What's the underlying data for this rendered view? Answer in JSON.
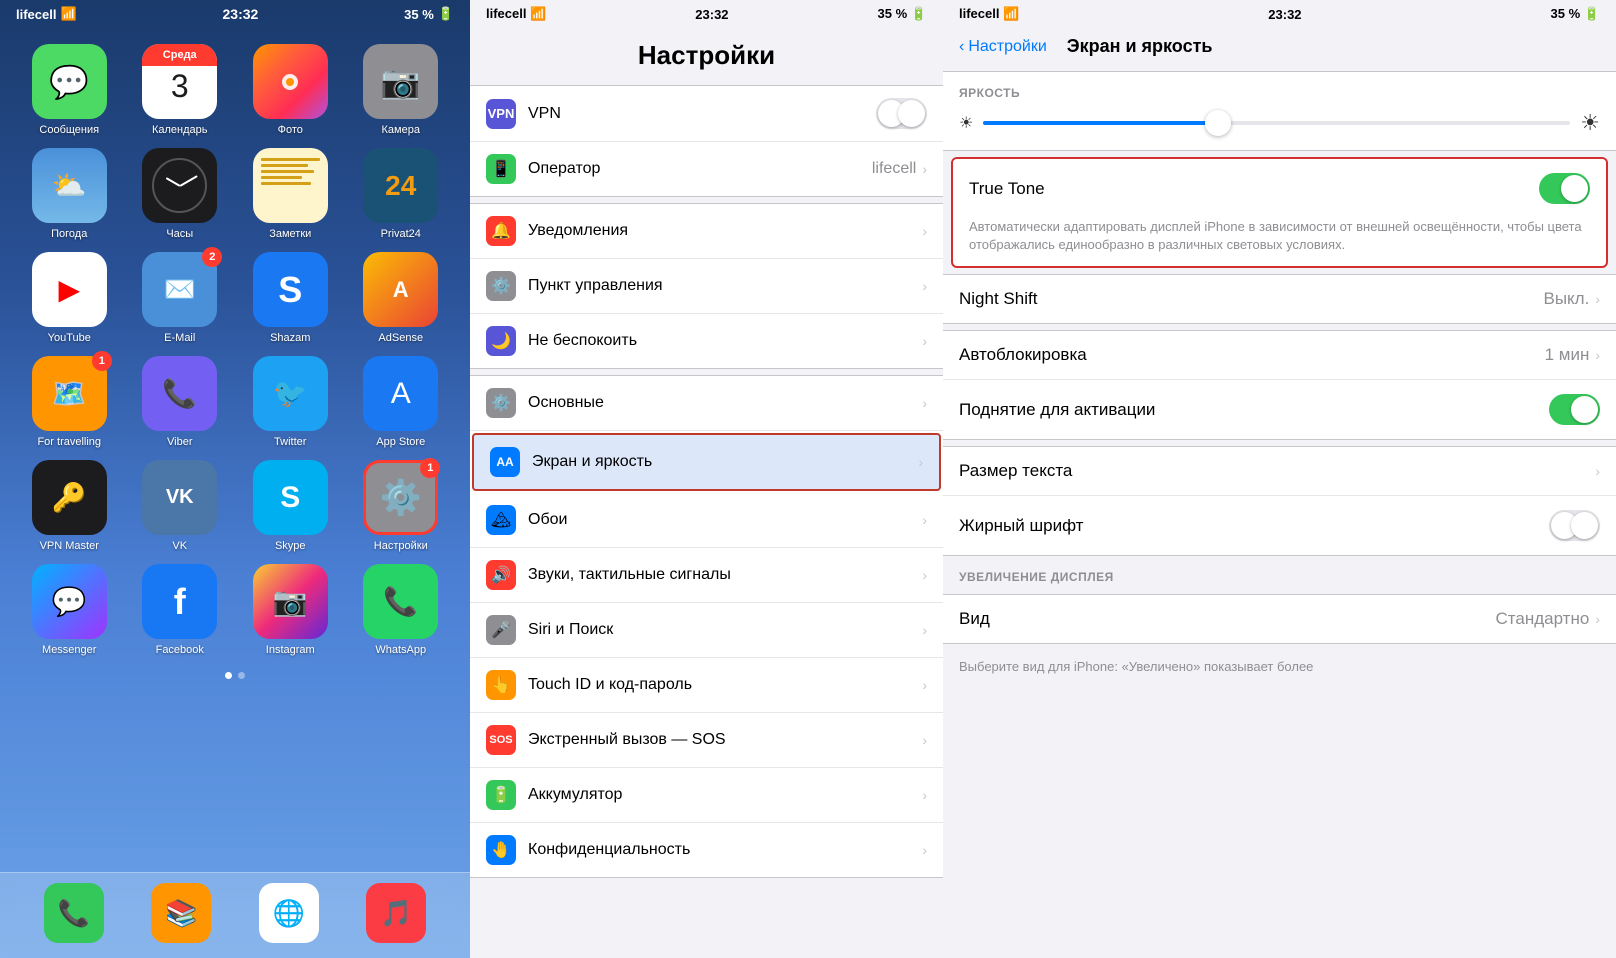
{
  "homescreen": {
    "status": {
      "carrier": "lifecell",
      "time": "23:32",
      "battery": "35 %",
      "signal": "●●●"
    },
    "apps": [
      {
        "id": "messages",
        "label": "Сообщения",
        "colorClass": "app-messages",
        "icon": "💬",
        "badge": null
      },
      {
        "id": "calendar",
        "label": "Календарь",
        "colorClass": "app-calendar",
        "icon": "",
        "badge": null
      },
      {
        "id": "photos",
        "label": "Фото",
        "colorClass": "app-photos",
        "icon": "🌸",
        "badge": null
      },
      {
        "id": "camera",
        "label": "Камера",
        "colorClass": "app-camera",
        "icon": "📷",
        "badge": null
      },
      {
        "id": "weather",
        "label": "Погода",
        "colorClass": "app-weather",
        "icon": "🌤",
        "badge": null
      },
      {
        "id": "clock",
        "label": "Часы",
        "colorClass": "app-clock",
        "icon": "",
        "badge": null
      },
      {
        "id": "notes",
        "label": "Заметки",
        "colorClass": "app-notes",
        "icon": "",
        "badge": null
      },
      {
        "id": "privat24",
        "label": "Privat24",
        "colorClass": "app-privat24",
        "icon": "24",
        "badge": null
      },
      {
        "id": "youtube",
        "label": "YouTube",
        "colorClass": "app-youtube",
        "icon": "▶",
        "badge": null
      },
      {
        "id": "email",
        "label": "E-Mail",
        "colorClass": "app-email",
        "icon": "✉️",
        "badge": "2"
      },
      {
        "id": "shazam",
        "label": "Shazam",
        "colorClass": "app-shazam",
        "icon": "S",
        "badge": null
      },
      {
        "id": "adsense",
        "label": "AdSense",
        "colorClass": "app-adsense",
        "icon": "A",
        "badge": null
      },
      {
        "id": "travelling",
        "label": "For travelling",
        "colorClass": "app-travelling",
        "icon": "📍",
        "badge": "1"
      },
      {
        "id": "viber",
        "label": "Viber",
        "colorClass": "app-viber",
        "icon": "📞",
        "badge": null
      },
      {
        "id": "twitter",
        "label": "Twitter",
        "colorClass": "app-twitter",
        "icon": "🐦",
        "badge": null
      },
      {
        "id": "appstore",
        "label": "App Store",
        "colorClass": "app-appstore",
        "icon": "A",
        "badge": null
      },
      {
        "id": "vpnmaster",
        "label": "VPN Master",
        "colorClass": "app-vpnmaster",
        "icon": "🔑",
        "badge": null
      },
      {
        "id": "vk",
        "label": "VK",
        "colorClass": "app-vk",
        "icon": "VK",
        "badge": null
      },
      {
        "id": "skype",
        "label": "Skype",
        "colorClass": "app-skype",
        "icon": "S",
        "badge": null
      },
      {
        "id": "settings",
        "label": "Настройки",
        "colorClass": "app-settings",
        "icon": "⚙️",
        "badge": "1"
      },
      {
        "id": "messenger",
        "label": "Messenger",
        "colorClass": "app-messenger",
        "icon": "💬",
        "badge": null
      },
      {
        "id": "facebook",
        "label": "Facebook",
        "colorClass": "app-facebook",
        "icon": "f",
        "badge": null
      },
      {
        "id": "instagram",
        "label": "Instagram",
        "colorClass": "app-instagram",
        "icon": "📷",
        "badge": null
      },
      {
        "id": "whatsapp",
        "label": "WhatsApp",
        "colorClass": "app-whatsapp",
        "icon": "📞",
        "badge": null
      }
    ],
    "dock": [
      {
        "id": "phone",
        "icon": "📞",
        "color": "#34c759"
      },
      {
        "id": "books",
        "icon": "📚",
        "color": "#ff9500"
      },
      {
        "id": "chrome",
        "icon": "🌐",
        "color": "#4285f4"
      },
      {
        "id": "music",
        "icon": "🎵",
        "color": "#fc3c44"
      }
    ],
    "calendarDay": "3",
    "calendarWeekday": "Среда"
  },
  "settings": {
    "status": {
      "carrier": "lifecell",
      "time": "23:32",
      "battery": "35 %"
    },
    "title": "Настройки",
    "rows": [
      {
        "id": "vpn",
        "icon": "🔒",
        "iconColor": "#5856d6",
        "label": "VPN",
        "value": "",
        "hasToggle": true,
        "toggleOn": false
      },
      {
        "id": "operator",
        "icon": "📱",
        "iconColor": "#34c759",
        "label": "Оператор",
        "value": "lifecell",
        "hasChevron": true
      },
      {
        "id": "notifications",
        "icon": "🔔",
        "iconColor": "#ff3b30",
        "label": "Уведомления",
        "value": "",
        "hasChevron": true
      },
      {
        "id": "control",
        "icon": "⚙️",
        "iconColor": "#8e8e93",
        "label": "Пункт управления",
        "value": "",
        "hasChevron": true
      },
      {
        "id": "dnd",
        "icon": "🌙",
        "iconColor": "#5856d6",
        "label": "Не беспокоить",
        "value": "",
        "hasChevron": true
      },
      {
        "id": "general",
        "icon": "⚙️",
        "iconColor": "#8e8e93",
        "label": "Основные",
        "value": "",
        "hasChevron": true
      },
      {
        "id": "display",
        "icon": "AA",
        "iconColor": "#007aff",
        "label": "Экран и яркость",
        "value": "",
        "hasChevron": true,
        "highlighted": true
      },
      {
        "id": "wallpaper",
        "icon": "🏔",
        "iconColor": "#007aff",
        "label": "Обои",
        "value": "",
        "hasChevron": true
      },
      {
        "id": "sounds",
        "icon": "🔊",
        "iconColor": "#ff3b30",
        "label": "Звуки, тактильные сигналы",
        "value": "",
        "hasChevron": true
      },
      {
        "id": "siri",
        "icon": "🎤",
        "iconColor": "#8e8e93",
        "label": "Siri и Поиск",
        "value": "",
        "hasChevron": true
      },
      {
        "id": "touchid",
        "icon": "👆",
        "iconColor": "#ff9500",
        "label": "Touch ID и код-пароль",
        "value": "",
        "hasChevron": true
      },
      {
        "id": "sos",
        "icon": "🆘",
        "iconColor": "#ff3b30",
        "label": "Экстренный вызов — SOS",
        "value": "",
        "hasChevron": true
      },
      {
        "id": "battery",
        "icon": "🔋",
        "iconColor": "#34c759",
        "label": "Аккумулятор",
        "value": "",
        "hasChevron": true
      },
      {
        "id": "privacy",
        "icon": "🤚",
        "iconColor": "#007aff",
        "label": "Конфиденциальность",
        "value": "",
        "hasChevron": true
      }
    ]
  },
  "display": {
    "status": {
      "carrier": "lifecell",
      "time": "23:32",
      "battery": "35 %"
    },
    "backLabel": "Настройки",
    "title": "Экран и яркость",
    "brightnessLabel": "ЯРКОСТЬ",
    "brightnessPercent": 40,
    "trueTone": {
      "label": "True Tone",
      "enabled": true,
      "description": "Автоматически адаптировать дисплей iPhone в зависимости от внешней освещённости, чтобы цвета отображались единообразно в различных световых условиях."
    },
    "nightShift": {
      "label": "Night Shift",
      "value": "Выкл."
    },
    "autolock": {
      "label": "Автоблокировка",
      "value": "1 мин"
    },
    "raisewake": {
      "label": "Поднятие для активации",
      "enabled": true
    },
    "textSize": {
      "label": "Размер текста"
    },
    "boldText": {
      "label": "Жирный шрифт",
      "enabled": false
    },
    "zoomLabel": "УВЕЛИЧЕНИЕ ДИСПЛЕЯ",
    "view": {
      "label": "Вид",
      "value": "Стандартно"
    },
    "viewDesc": "Выберите вид для iPhone: «Увеличено» показывает более"
  }
}
